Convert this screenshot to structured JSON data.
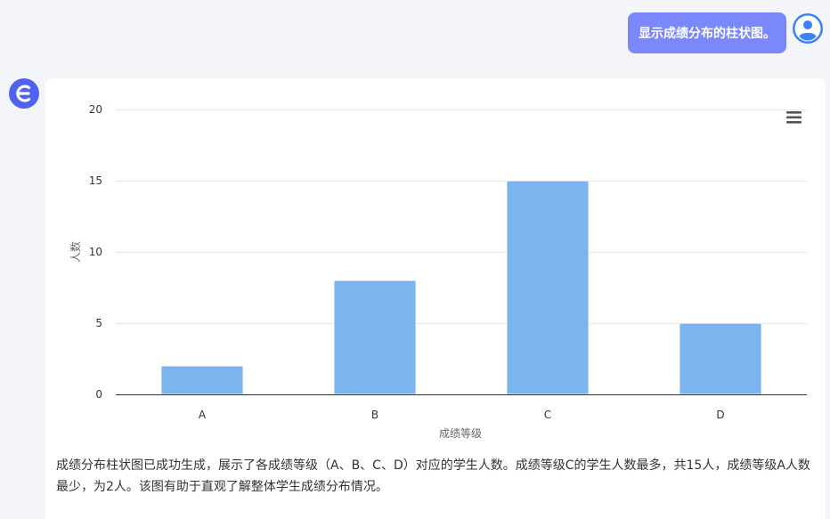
{
  "user_message": {
    "text": "显示成绩分布的柱状图。"
  },
  "icons": {
    "user_avatar": "user-avatar-icon",
    "bot_avatar": "bot-logo-icon",
    "chart_menu": "hamburger-menu-icon"
  },
  "colors": {
    "user_bubble": "#7b88fb",
    "bot_logo": "#4f63f0",
    "bar": "#7cb5ec",
    "avatar": "#3b82f6"
  },
  "chart_data": {
    "type": "bar",
    "categories": [
      "A",
      "B",
      "C",
      "D"
    ],
    "values": [
      2,
      8,
      15,
      5
    ],
    "xlabel": "成绩等级",
    "ylabel": "人数",
    "ylim": [
      0,
      20
    ],
    "yticks": [
      0,
      5,
      10,
      15,
      20
    ],
    "grid": true,
    "legend": "none"
  },
  "summary": {
    "text": "成绩分布柱状图已成功生成，展示了各成绩等级（A、B、C、D）对应的学生人数。成绩等级C的学生人数最多，共15人，成绩等级A人数最少，为2人。该图有助于直观了解整体学生成绩分布情况。"
  }
}
